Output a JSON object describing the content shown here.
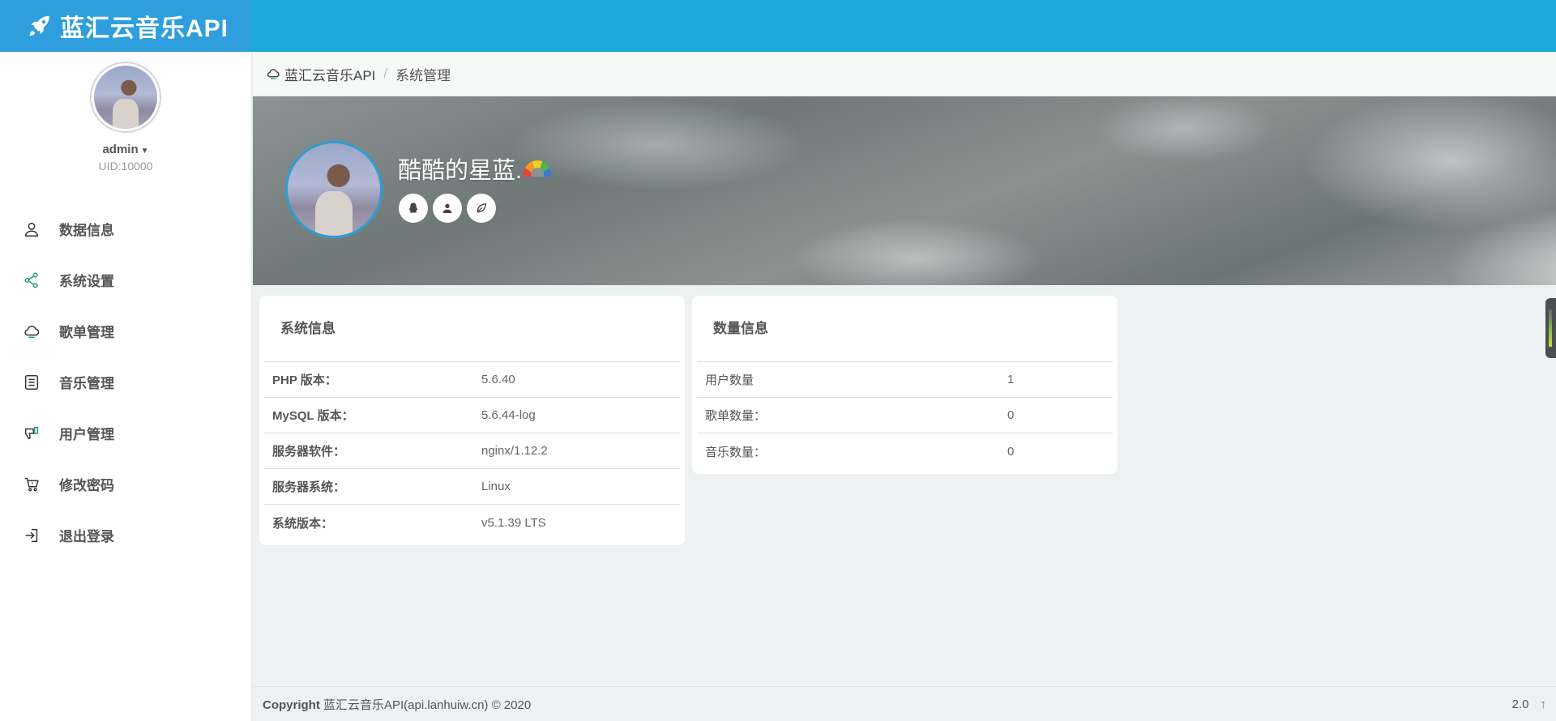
{
  "brand": {
    "name": "蓝汇云音乐API"
  },
  "user": {
    "name": "admin",
    "uid": "UID:10000"
  },
  "nav": [
    {
      "label": "数据信息",
      "icon": "user-icon"
    },
    {
      "label": "系统设置",
      "icon": "share-icon"
    },
    {
      "label": "歌单管理",
      "icon": "cloud-icon"
    },
    {
      "label": "音乐管理",
      "icon": "list-icon"
    },
    {
      "label": "用户管理",
      "icon": "thumbs-down-icon"
    },
    {
      "label": "修改密码",
      "icon": "cart-icon"
    },
    {
      "label": "退出登录",
      "icon": "logout-icon"
    }
  ],
  "breadcrumb": {
    "home": "蓝汇云音乐API",
    "sep": "/",
    "current": "系统管理"
  },
  "banner": {
    "nickname": "酷酷的星蓝."
  },
  "system_info": {
    "title": "系统信息",
    "rows": [
      {
        "k": "PHP 版本：",
        "v": "5.6.40"
      },
      {
        "k": "MySQL 版本：",
        "v": "5.6.44-log"
      },
      {
        "k": "服务器软件：",
        "v": "nginx/1.12.2"
      },
      {
        "k": "服务器系统：",
        "v": "Linux"
      },
      {
        "k": "系统版本：",
        "v": "v5.1.39 LTS"
      }
    ]
  },
  "count_info": {
    "title": "数量信息",
    "rows": [
      {
        "k": "用户数量",
        "v": "1"
      },
      {
        "k": "歌单数量：",
        "v": "0"
      },
      {
        "k": "音乐数量：",
        "v": "0"
      }
    ]
  },
  "footer": {
    "copyright_label": "Copyright",
    "copyright_text": "蓝汇云音乐API(api.lanhuiw.cn) © 2020",
    "version": "2.0",
    "up": "↑"
  },
  "colors": {
    "topbar": "#1ba9d9",
    "brand": "#2e9fdc",
    "accent": "#2a9fd6",
    "nav_icon_accent": "#1aa36b"
  }
}
